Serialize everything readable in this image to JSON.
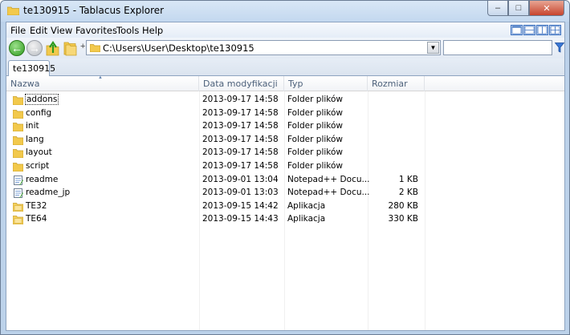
{
  "window": {
    "title": "te130915 - Tablacus Explorer",
    "buttons": {
      "minimize": "‒",
      "maximize": "□",
      "close": "✕"
    }
  },
  "menu": [
    {
      "label": "File"
    },
    {
      "label": "Edit"
    },
    {
      "label": "View"
    },
    {
      "label": "Favorites"
    },
    {
      "label": "Tools"
    },
    {
      "label": "Help"
    }
  ],
  "toolbar": {
    "address": "C:\\Users\\User\\Desktop\\te130915",
    "address_plus": "+",
    "search_placeholder": ""
  },
  "tabs": [
    {
      "label": "te130915"
    }
  ],
  "list": {
    "columns": [
      "Nazwa",
      "Data modyfikacji",
      "Typ",
      "Rozmiar"
    ],
    "rows": [
      {
        "name": "addons",
        "date": "2013-09-17 14:58",
        "type": "Folder plików",
        "size": "",
        "icon": "folder-icon"
      },
      {
        "name": "config",
        "date": "2013-09-17 14:58",
        "type": "Folder plików",
        "size": "",
        "icon": "folder-icon"
      },
      {
        "name": "init",
        "date": "2013-09-17 14:58",
        "type": "Folder plików",
        "size": "",
        "icon": "folder-icon"
      },
      {
        "name": "lang",
        "date": "2013-09-17 14:58",
        "type": "Folder plików",
        "size": "",
        "icon": "folder-icon"
      },
      {
        "name": "layout",
        "date": "2013-09-17 14:58",
        "type": "Folder plików",
        "size": "",
        "icon": "folder-icon"
      },
      {
        "name": "script",
        "date": "2013-09-17 14:58",
        "type": "Folder plików",
        "size": "",
        "icon": "folder-icon"
      },
      {
        "name": "readme",
        "date": "2013-09-01 13:04",
        "type": "Notepad++ Docu...",
        "size": "1 KB",
        "icon": "text-file-icon"
      },
      {
        "name": "readme_jp",
        "date": "2013-09-01 13:03",
        "type": "Notepad++ Docu...",
        "size": "2 KB",
        "icon": "text-file-icon"
      },
      {
        "name": "TE32",
        "date": "2013-09-15 14:42",
        "type": "Aplikacja",
        "size": "280 KB",
        "icon": "application-icon"
      },
      {
        "name": "TE64",
        "date": "2013-09-15 14:43",
        "type": "Aplikacja",
        "size": "330 KB",
        "icon": "application-icon"
      }
    ]
  }
}
